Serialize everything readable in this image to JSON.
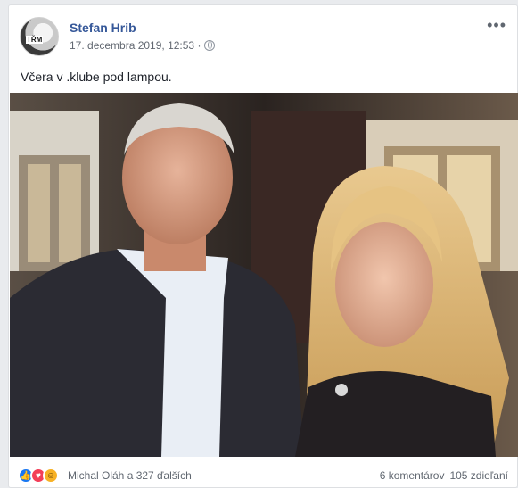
{
  "post": {
    "author": "Stefan Hrib",
    "avatar_badge": "TŘM",
    "timestamp": "17. decembra 2019, 12:53 ·",
    "privacy_icon": "globe-icon",
    "more_icon": "more-options-icon",
    "text": "Včera v .klube pod lampou.",
    "photo_icon": "photo-image"
  },
  "footer": {
    "reaction_icons": [
      "like-icon",
      "love-icon",
      "haha-icon"
    ],
    "reactors_text": "Michal Oláh a 327 ďalších",
    "comments": "6 komentárov",
    "shares": "105 zdieľaní"
  },
  "colors": {
    "link_blue": "#365899",
    "like_blue": "#1877f2",
    "love_red": "#f33e58",
    "haha_yellow": "#f7b125"
  }
}
